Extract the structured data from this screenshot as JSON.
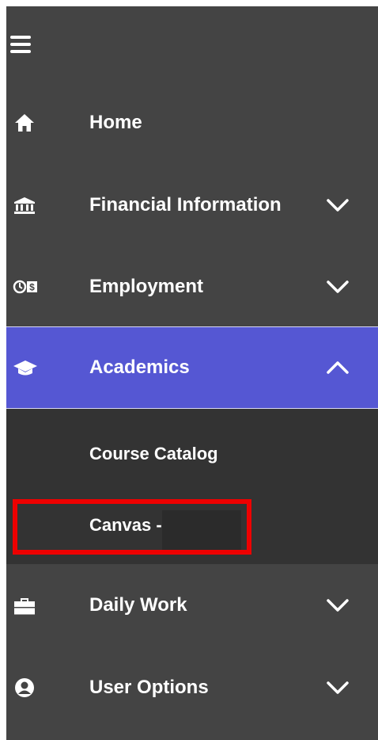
{
  "nav": {
    "menu_icon": "hamburger-icon",
    "items": [
      {
        "id": "home",
        "label": "Home",
        "icon": "home-icon"
      },
      {
        "id": "financial",
        "label": "Financial Information",
        "icon": "bank-icon",
        "chevron": "down"
      },
      {
        "id": "employment",
        "label": "Employment",
        "icon": "time-money-icon",
        "chevron": "down"
      },
      {
        "id": "academics",
        "label": "Academics",
        "icon": "graduation-cap-icon",
        "chevron": "up",
        "expanded": true
      },
      {
        "id": "daily-work",
        "label": "Daily Work",
        "icon": "briefcase-icon",
        "chevron": "down"
      },
      {
        "id": "user-options",
        "label": "User Options",
        "icon": "user-circle-icon",
        "chevron": "down"
      }
    ],
    "academics_submenu": [
      {
        "label": "Course Catalog"
      },
      {
        "label": "Canvas -",
        "highlighted": true
      }
    ]
  },
  "colors": {
    "sidebar_bg": "#444444",
    "submenu_bg": "#333333",
    "active_bg": "#5557d3",
    "highlight_border": "#ee0000",
    "text": "#ffffff"
  }
}
